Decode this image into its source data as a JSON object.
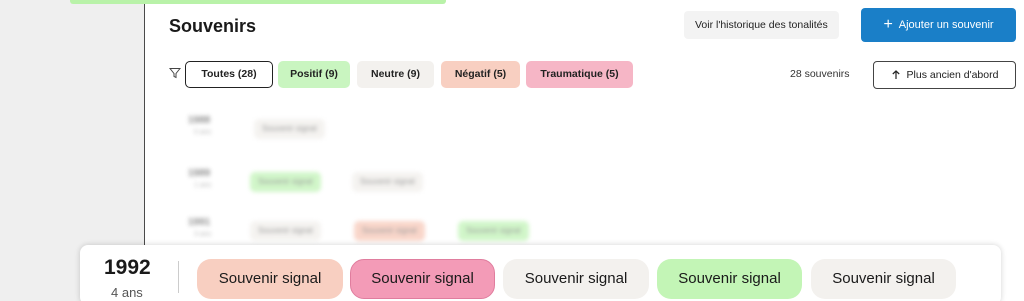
{
  "header": {
    "title": "Souvenirs",
    "history_button": "Voir l'historique des tonalités",
    "add_button": "Ajouter un souvenir"
  },
  "filters": {
    "all": "Toutes (28)",
    "positive": "Positif (9)",
    "neutral": "Neutre (9)",
    "negative": "Négatif (5)",
    "traumatic": "Traumatique (5)"
  },
  "count_label": "28 souvenirs",
  "sort_button": "Plus ancien d'abord",
  "blurred_rows": [
    {
      "year": "1988",
      "age": "0 ans",
      "chips": [
        "Souvenir signal"
      ]
    },
    {
      "year": "1989",
      "age": "1 ans",
      "chips": [
        "Souvenir signal",
        "Souvenir signal"
      ]
    },
    {
      "year": "1991",
      "age": "3 ans",
      "chips": [
        "Souvenir signal",
        "Souvenir signal",
        "Souvenir signal"
      ]
    }
  ],
  "focused_row": {
    "year": "1992",
    "age": "4 ans",
    "chips": [
      "Souvenir signal",
      "Souvenir signal",
      "Souvenir signal",
      "Souvenir signal",
      "Souvenir signal"
    ]
  },
  "colors": {
    "accent": "#1a7fc8",
    "positive": "#c9f5c0",
    "neutral": "#f3f1ee",
    "negative": "#f8cfc1",
    "traumatic": "#f6b6c6"
  },
  "icons": {
    "filter": "filter-icon",
    "add": "plus-icon",
    "sort": "arrow-up-icon"
  }
}
